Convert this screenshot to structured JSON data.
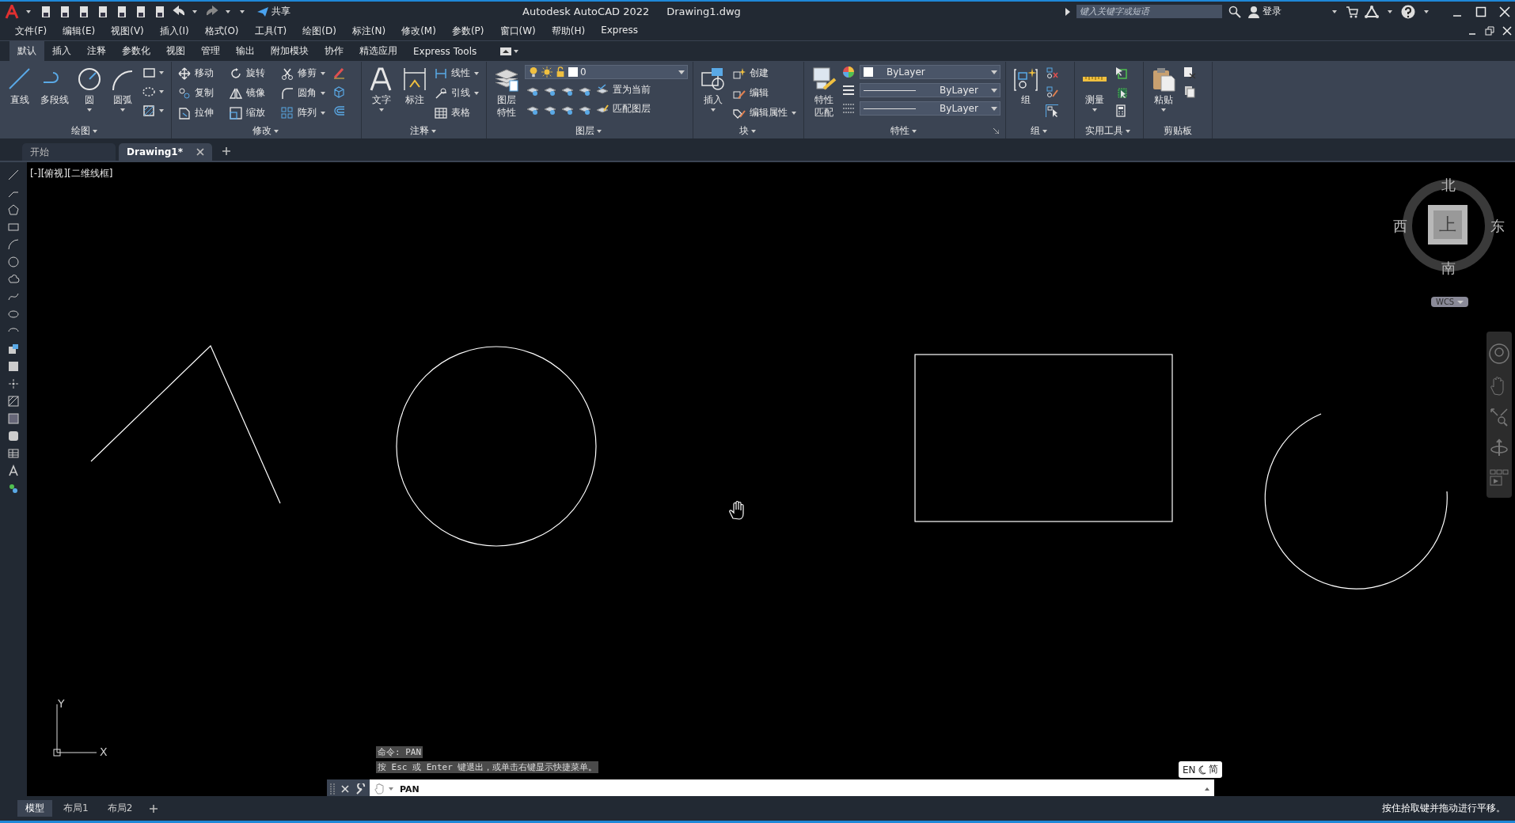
{
  "title_bar": {
    "share": "共享",
    "title": "Autodesk AutoCAD 2022",
    "file": "Drawing1.dwg",
    "search": {
      "placeholder": "键入关键字或短语"
    },
    "login": "登录"
  },
  "menu": [
    "文件(F)",
    "编辑(E)",
    "视图(V)",
    "插入(I)",
    "格式(O)",
    "工具(T)",
    "绘图(D)",
    "标注(N)",
    "修改(M)",
    "参数(P)",
    "窗口(W)",
    "帮助(H)",
    "Express"
  ],
  "ribbon_tabs": [
    {
      "label": "默认",
      "selected": true
    },
    {
      "label": "插入",
      "selected": false
    },
    {
      "label": "注释",
      "selected": false
    },
    {
      "label": "参数化",
      "selected": false
    },
    {
      "label": "视图",
      "selected": false
    },
    {
      "label": "管理",
      "selected": false
    },
    {
      "label": "输出",
      "selected": false
    },
    {
      "label": "附加模块",
      "selected": false
    },
    {
      "label": "协作",
      "selected": false
    },
    {
      "label": "精选应用",
      "selected": false
    },
    {
      "label": "Express Tools",
      "selected": false
    }
  ],
  "ribbon_panels": [
    {
      "kind": "draw",
      "title": "绘图",
      "large": [
        "直线",
        "多段线",
        "圆",
        "圆弧"
      ]
    },
    {
      "kind": "modify",
      "title": "修改",
      "small": [
        "移动",
        "旋转",
        "修剪",
        "复制",
        "镜像",
        "圆角",
        "拉伸",
        "缩放",
        "阵列"
      ]
    },
    {
      "kind": "annotate",
      "title": "注释",
      "large": [
        "文字",
        "标注"
      ],
      "small": [
        "线性",
        "引线",
        "表格"
      ]
    },
    {
      "kind": "layers",
      "title": "图层",
      "large": [
        "图层特性"
      ],
      "layer": "0",
      "small": [
        "置为当前",
        "匹配图层"
      ]
    },
    {
      "kind": "block",
      "title": "块",
      "large": [
        "插入"
      ],
      "small": [
        "创建",
        "编辑",
        "编辑属性"
      ]
    },
    {
      "kind": "properties",
      "title": "特性",
      "large": [
        "特性匹配"
      ],
      "dropdowns": [
        "ByLayer",
        "ByLayer",
        "ByLayer"
      ]
    },
    {
      "kind": "group",
      "title": "组",
      "large": [
        "组"
      ]
    },
    {
      "kind": "utilities",
      "title": "实用工具",
      "large": [
        "测量"
      ]
    },
    {
      "kind": "clipboard",
      "title": "剪贴板",
      "large": [
        "粘贴"
      ]
    }
  ],
  "doc_tabs": [
    {
      "label": "开始",
      "selected": false
    },
    {
      "label": "Drawing1*",
      "selected": true
    }
  ],
  "viewport_label": "[-][俯视][二维线框]",
  "viewcube": {
    "north": "北",
    "south": "南",
    "west": "西",
    "east": "东",
    "face": "上",
    "wcs": "WCS"
  },
  "ucs": {
    "y": "Y",
    "x": "X"
  },
  "command_history": [
    "命令: PAN",
    "按 Esc 或 Enter 键退出，或单击右键显示快捷菜单。"
  ],
  "command_line": {
    "value": "PAN"
  },
  "ime": {
    "lang": "EN",
    "mode": "简"
  },
  "layout_tabs": [
    {
      "label": "模型",
      "selected": true
    },
    {
      "label": "布局1",
      "selected": false
    },
    {
      "label": "布局2",
      "selected": false
    }
  ],
  "status_text": "按住拾取键并拖动进行平移。"
}
